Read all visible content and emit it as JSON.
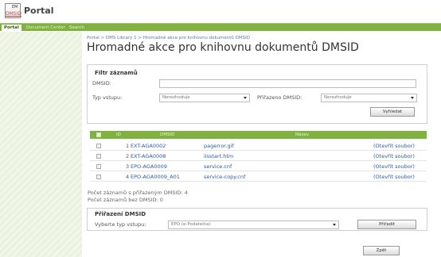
{
  "app": {
    "logo_top": "EM",
    "logo_bottom": "DMSID",
    "title": "Portal"
  },
  "nav": {
    "tabs": [
      {
        "label": "Portal"
      },
      {
        "label": "Document Center"
      },
      {
        "label": "Search"
      }
    ]
  },
  "breadcrumb": "Portal > DMS Library 1 > Hromadné akce pro knihovnu dokumentů DMSID",
  "page_title": "Hromadné akce pro knihovnu dokumentů DMSID",
  "filter": {
    "title": "Filtr záznamů",
    "dmsid_label": "DMSID:",
    "dmsid_value": "",
    "typ_label": "Typ vstupu:",
    "typ_value": "Nerozhoduje",
    "prirazeno_label": "Přiřazeno DMSID:",
    "prirazeno_value": "Nerozhoduje",
    "search_button": "Vyhledat"
  },
  "table": {
    "headers": {
      "id": "ID",
      "dmsid": "DMSID",
      "nazev": "Název"
    },
    "rows": [
      {
        "id": "1",
        "dmsid": "EXT-AGA0002",
        "nazev": "pagerror.gif",
        "action": "(Otevřít soubor)"
      },
      {
        "id": "2",
        "dmsid": "EXT-AGA0008",
        "nazev": "iisstart.htm",
        "action": "(Otevřít soubor)"
      },
      {
        "id": "3",
        "dmsid": "EPO-AGA0009",
        "nazev": "service.cnf",
        "action": "(Otevřít soubor)"
      },
      {
        "id": "4",
        "dmsid": "EPO-AGA0009_A01",
        "nazev": "service-copy.cnf",
        "action": "(Otevřít soubor)"
      }
    ]
  },
  "counts": {
    "with_dmsid": "Počet záznamů s přiřazeným DMSID: 4",
    "without_dmsid": "Počet záznamů bez DMSID: 0"
  },
  "assign": {
    "title": "Přiřazení DMSID",
    "typ_label": "Vyberte typ vstupu:",
    "typ_value": "EPO (e-Podatelna)",
    "assign_button": "Přiřadit"
  },
  "back_button": "Zpět",
  "colors": {
    "accent": "#7fb23f",
    "link": "#2a5aa8"
  }
}
